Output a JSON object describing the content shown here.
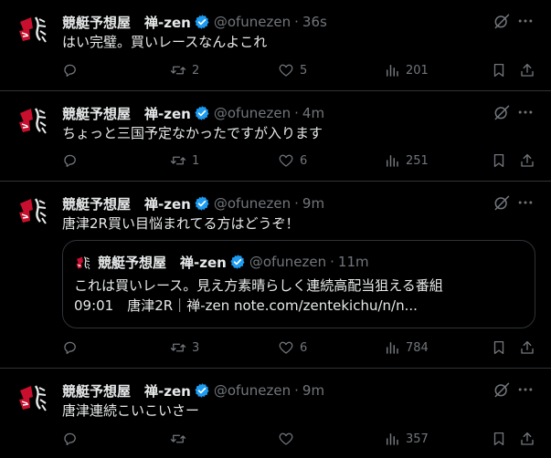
{
  "colors": {
    "background": "#000000",
    "text": "#e7e9ea",
    "muted": "#71767b",
    "border": "#2f3336",
    "verified": "#1d9bf0"
  },
  "tweets": [
    {
      "name": "競艇予想屋　禅-zen",
      "handle": "@ofunezen",
      "time": "36s",
      "text": "はい完璧。買いレースなんよこれ",
      "replies": "",
      "retweets": "2",
      "likes": "5",
      "views": "201"
    },
    {
      "name": "競艇予想屋　禅-zen",
      "handle": "@ofunezen",
      "time": "4m",
      "text": "ちょっと三国予定なかったですが入ります",
      "replies": "",
      "retweets": "1",
      "likes": "6",
      "views": "251"
    },
    {
      "name": "競艇予想屋　禅-zen",
      "handle": "@ofunezen",
      "time": "9m",
      "text": "唐津2R買い目悩まれてる方はどうぞ！",
      "replies": "",
      "retweets": "3",
      "likes": "6",
      "views": "784",
      "quote": {
        "name": "競艇予想屋　禅-zen",
        "handle": "@ofunezen",
        "time": "11m",
        "line1": "これは買いレース。見え方素晴らしく連続高配当狙える番組",
        "line2": "09:01　唐津2R｜禅-zen note.com/zentekichu/n/n..."
      }
    },
    {
      "name": "競艇予想屋　禅-zen",
      "handle": "@ofunezen",
      "time": "9m",
      "text": "唐津連続こいこいさー",
      "replies": "",
      "retweets": "",
      "likes": "",
      "views": "357"
    }
  ]
}
